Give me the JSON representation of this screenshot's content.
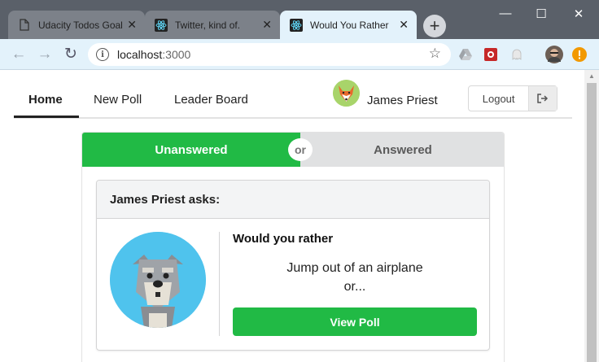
{
  "browser": {
    "tabs": [
      {
        "title": "Udacity Todos Goal",
        "icon": "document-icon"
      },
      {
        "title": "Twitter, kind of.",
        "icon": "react-icon"
      },
      {
        "title": "Would You Rather",
        "icon": "react-icon"
      }
    ],
    "new_tab_label": "+",
    "url_host": "localhost",
    "url_port": ":3000"
  },
  "app": {
    "nav": {
      "home": "Home",
      "new_poll": "New Poll",
      "leader_board": "Leader Board"
    },
    "user": {
      "name": "James Priest",
      "avatar": "fox-avatar"
    },
    "logout_label": "Logout",
    "tabs": {
      "unanswered": "Unanswered",
      "or": "or",
      "answered": "Answered"
    },
    "question": {
      "header": "James Priest asks:",
      "avatar": "schnauzer-avatar",
      "title": "Would you rather",
      "option": "Jump out of an airplane",
      "or_text": "or...",
      "button": "View Poll"
    }
  },
  "colors": {
    "accent_green": "#21ba45",
    "chrome_bar": "#e3f2fb",
    "titlebar": "#5a6069"
  }
}
